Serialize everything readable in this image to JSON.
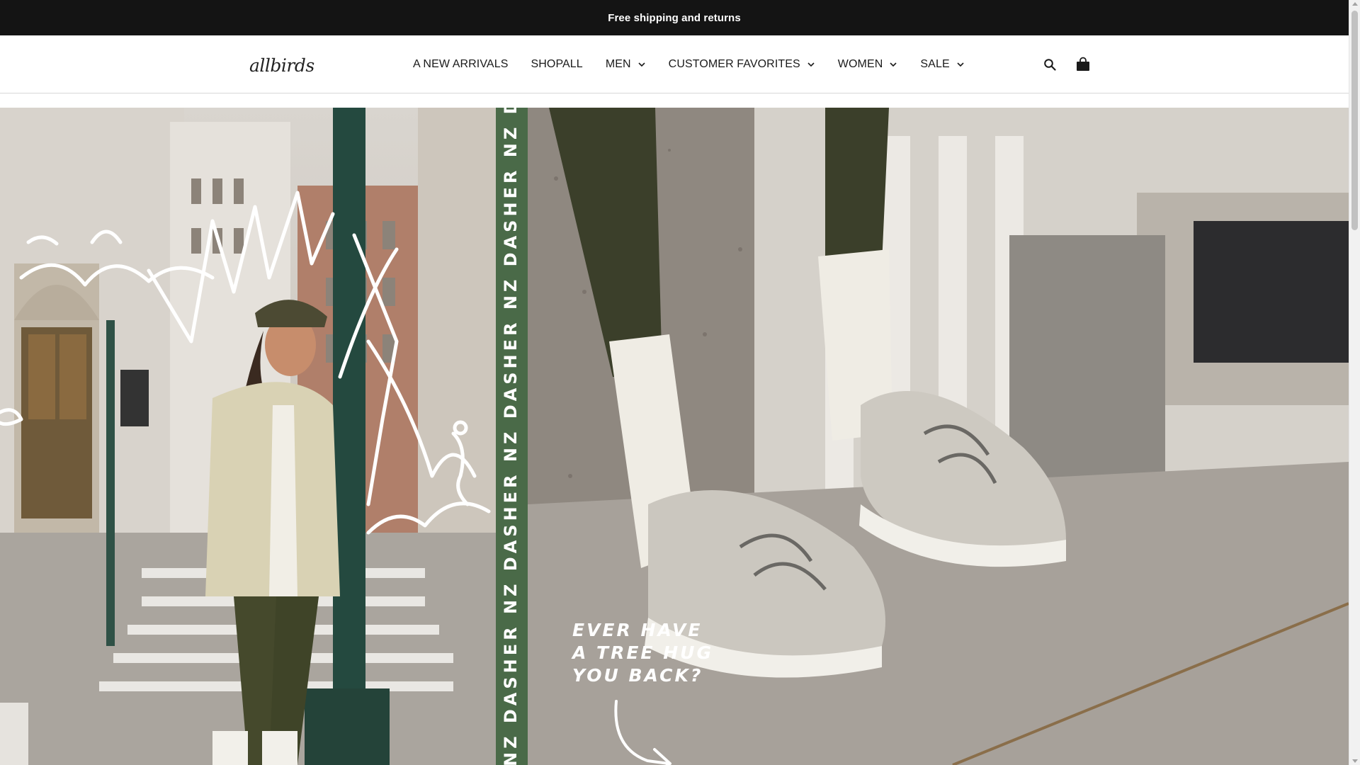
{
  "announcement": {
    "text": "Free shipping and returns"
  },
  "header": {
    "logo_text": "allbirds",
    "nav": [
      {
        "label": "A NEW ARRIVALS",
        "has_dropdown": false
      },
      {
        "label": "SHOPALL",
        "has_dropdown": false
      },
      {
        "label": "MEN",
        "has_dropdown": true
      },
      {
        "label": "CUSTOMER FAVORITES",
        "has_dropdown": true
      },
      {
        "label": "WOMEN",
        "has_dropdown": true
      },
      {
        "label": "SALE",
        "has_dropdown": true
      }
    ],
    "icons": [
      "search-icon",
      "shopping-bag-icon"
    ]
  },
  "hero": {
    "stripe_text": "NZ DASHER NZ DASHER NZ DASHER NZ DASHER NZ DASHER NZ DASHER NZ DASHER NZ",
    "tagline": [
      "EVER HAVE",
      "A TREE HUG",
      "YOU BACK?"
    ],
    "colors": {
      "stripe": "#4a6a48",
      "announcement_bg": "#141414"
    }
  }
}
